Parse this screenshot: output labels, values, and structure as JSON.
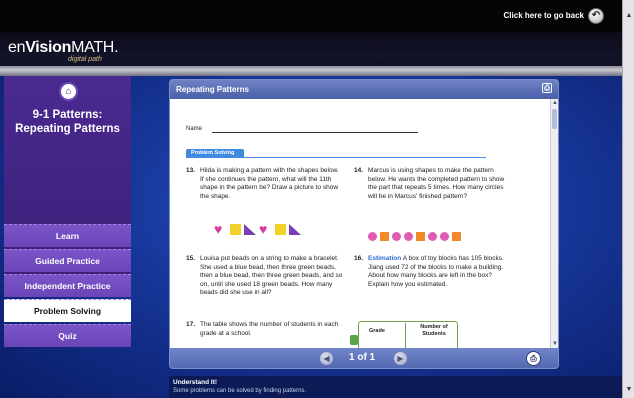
{
  "topbar": {
    "go_back": "Click here to go back"
  },
  "brand": {
    "name_a": "en",
    "name_b": "Vision",
    "name_c": "MATH",
    "tm": ".",
    "sub": "digital path"
  },
  "sidebar": {
    "lesson_title": "9-1 Patterns: Repeating Patterns",
    "items": [
      {
        "label": "Learn",
        "active": false
      },
      {
        "label": "Guided Practice",
        "active": false
      },
      {
        "label": "Independent Practice",
        "active": false
      },
      {
        "label": "Problem Solving",
        "active": true
      },
      {
        "label": "Quiz",
        "active": false
      }
    ]
  },
  "panel": {
    "title": "Repeating Patterns",
    "doc": {
      "name_label": "Name",
      "section_tab": "Problem Solving",
      "problems": [
        {
          "num": "13.",
          "text": "Hilda is making a pattern with the shapes below. If she continues the pattern, what will the 11th shape in the pattern be? Draw a picture to show the shape."
        },
        {
          "num": "14.",
          "text": "Marcus is using shapes to make the pattern below. He wants the completed pattern to show the part that repeats 5 times. How many circles will be in Marcus' finished pattern?"
        },
        {
          "num": "15.",
          "text": "Louisa put beads on a string to make a bracelet. She used a blue bead, then three green beads, then a blue bead, then three green beads, and so on, until she used 18 green beads. How many beads did she use in all?"
        },
        {
          "num": "16.",
          "keyword": "Estimation",
          "text": "A box of toy blocks has 105 blocks. Jiang used 72 of the blocks to make a building. About how many blocks are left in the box? Explain how you estimated."
        },
        {
          "num": "17.",
          "text": "The table shows the number of students in each grade at a school."
        }
      ],
      "table_headers": {
        "grade": "Grade",
        "students": "Number of Students"
      }
    },
    "pager": {
      "text": "1 of 1"
    }
  },
  "understand": {
    "title": "Understand It!",
    "text": "Some problems can be solved by finding patterns."
  },
  "colors": {
    "sidebar": "#3b1f78",
    "accent": "#3f8be0",
    "panel_bar": "#5267b0"
  }
}
